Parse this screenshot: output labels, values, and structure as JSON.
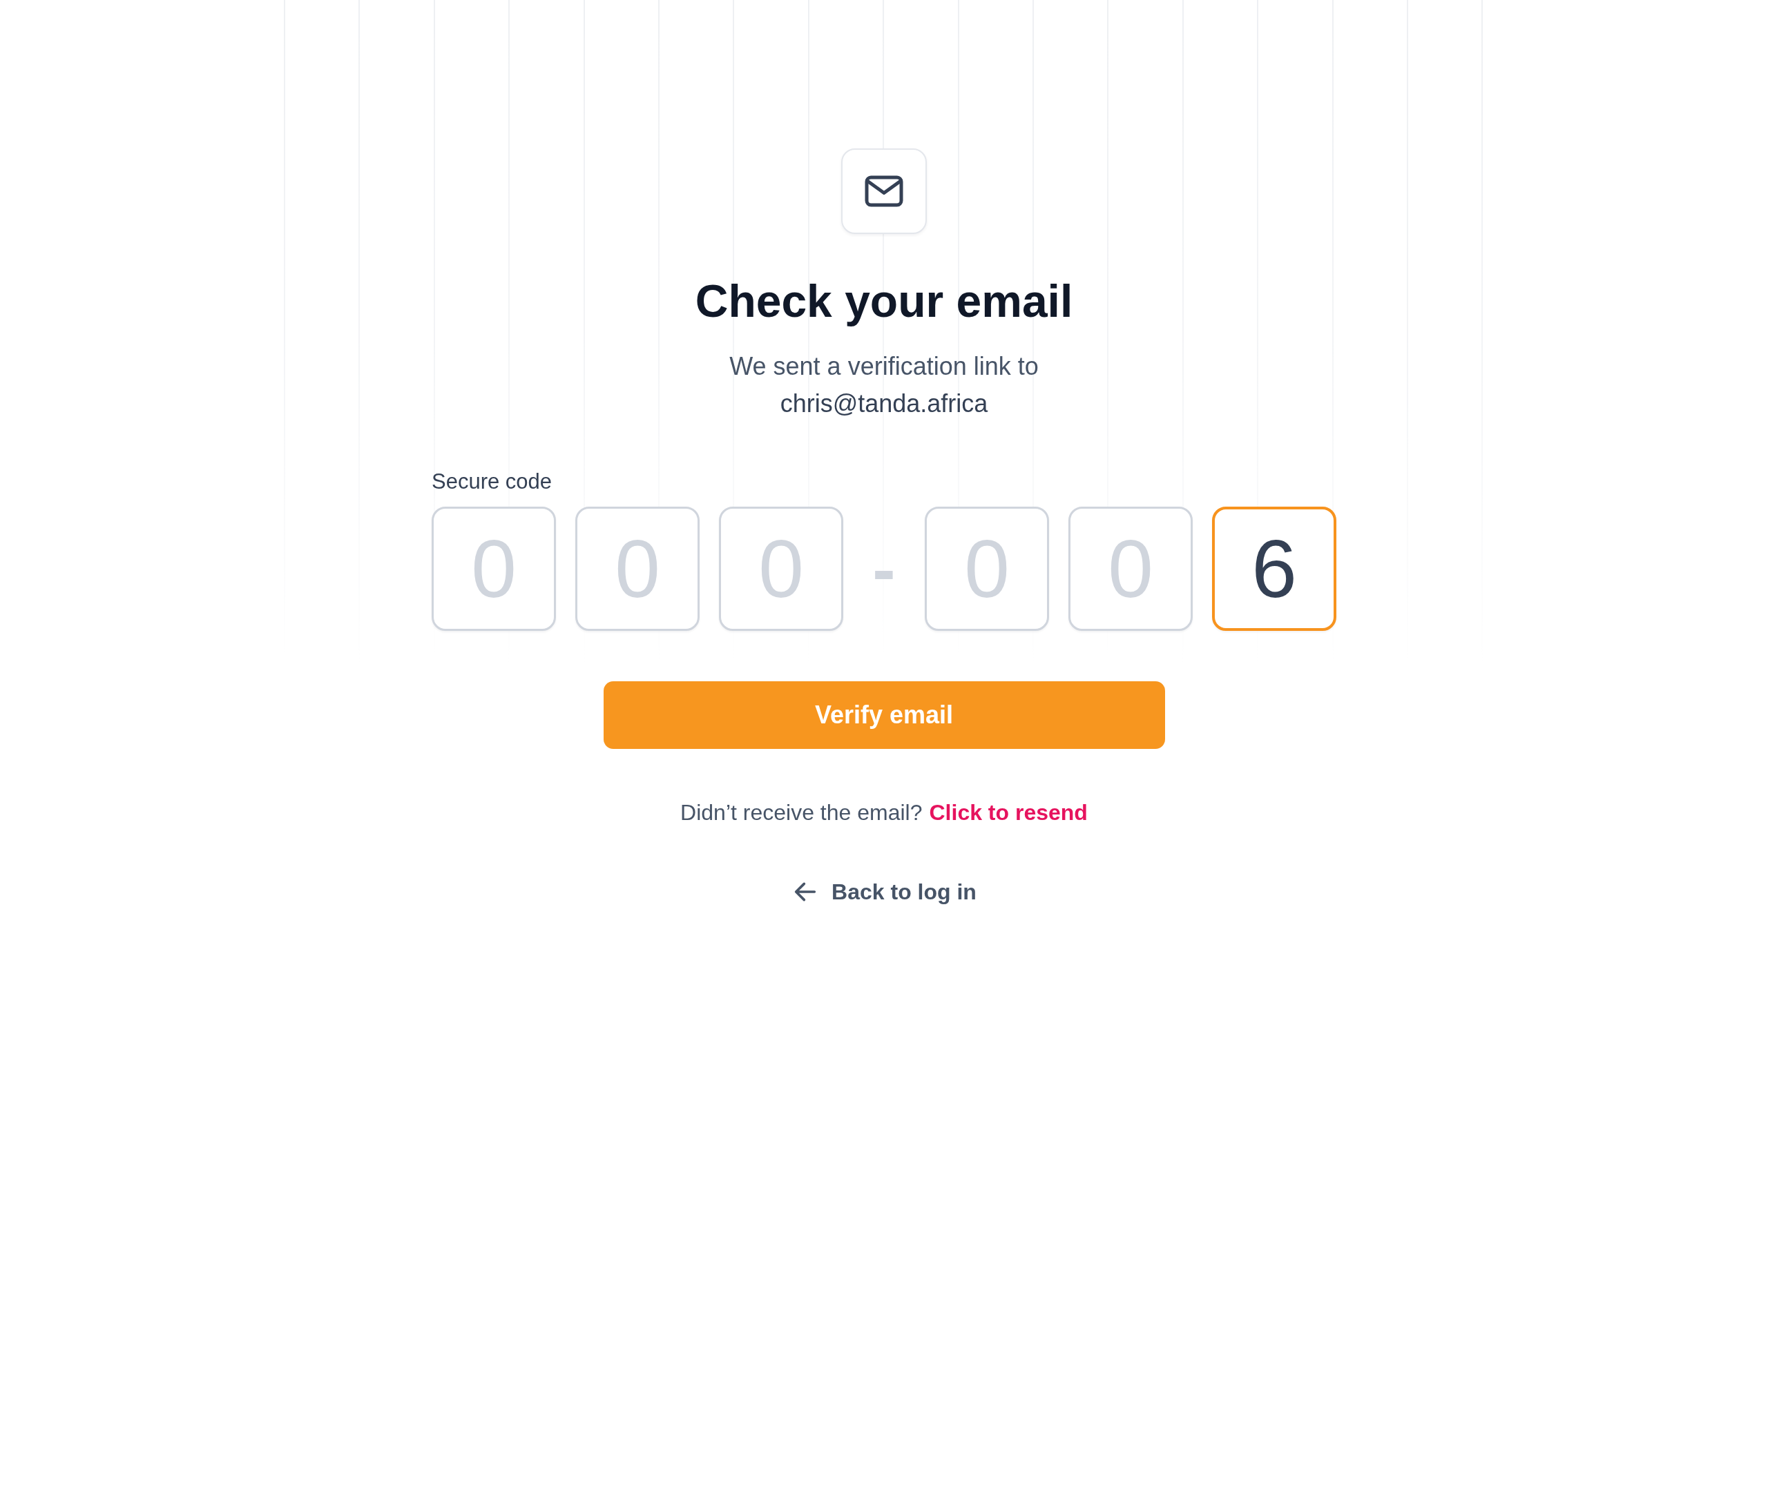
{
  "title": "Check your email",
  "subtitle": "We sent a verification link to",
  "email": "chris@tanda.africa",
  "code": {
    "label": "Secure code",
    "separator": "-",
    "groups": [
      [
        {
          "placeholder": "0",
          "focused": false
        },
        {
          "placeholder": "0",
          "focused": false
        },
        {
          "placeholder": "0",
          "focused": false
        }
      ],
      [
        {
          "placeholder": "0",
          "focused": false
        },
        {
          "placeholder": "0",
          "focused": false
        },
        {
          "value": "6",
          "focused": true
        }
      ]
    ]
  },
  "verify_button": "Verify email",
  "resend": {
    "prompt": "Didn’t receive the email?",
    "link": "Click to resend"
  },
  "back_link": "Back to log in"
}
